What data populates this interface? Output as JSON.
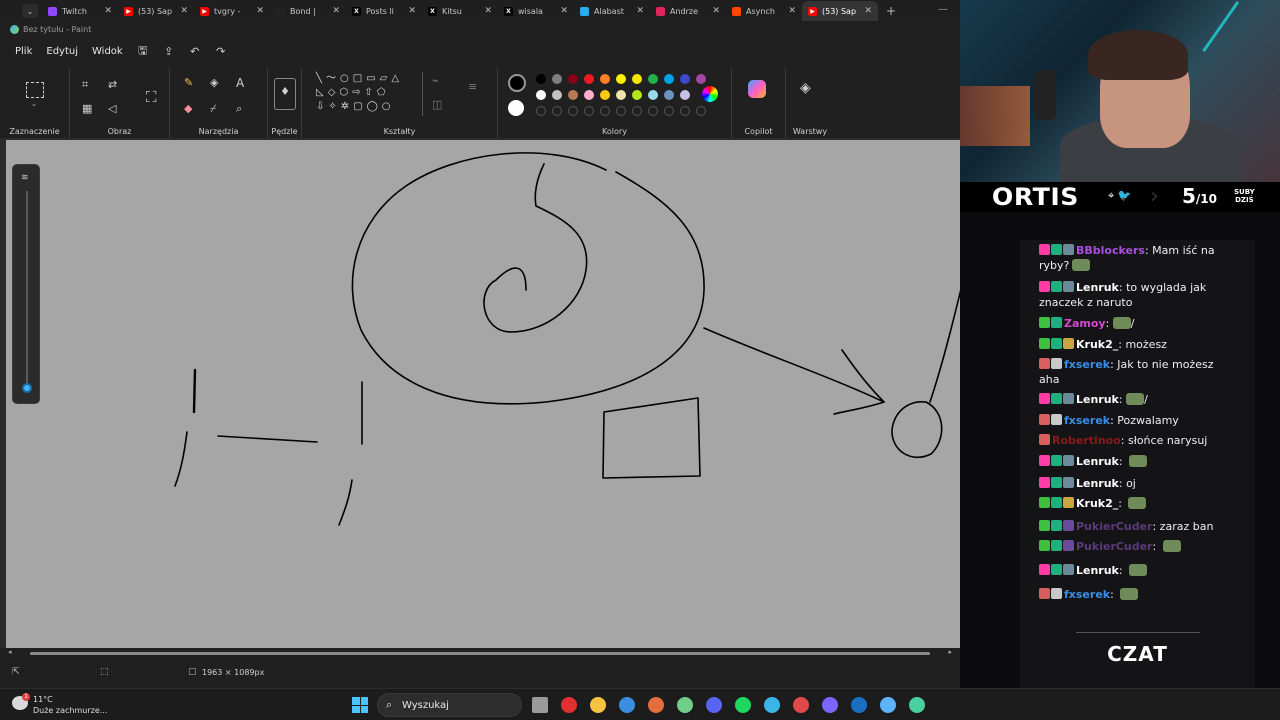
{
  "browser": {
    "tabs": [
      {
        "title": "Twitch",
        "favicon_color": "#9146ff",
        "favicon_glyph": ""
      },
      {
        "title": "(53) Sap",
        "favicon_color": "#ff0000",
        "favicon_glyph": "▶"
      },
      {
        "title": "tvgry -",
        "favicon_color": "#ff0000",
        "favicon_glyph": "▶"
      },
      {
        "title": "Bond |",
        "favicon_color": "#222222",
        "favicon_glyph": ""
      },
      {
        "title": "Posts li",
        "favicon_color": "#000000",
        "favicon_glyph": "X"
      },
      {
        "title": "Kitsu",
        "favicon_color": "#000000",
        "favicon_glyph": "X"
      },
      {
        "title": "wisala",
        "favicon_color": "#000000",
        "favicon_glyph": "X"
      },
      {
        "title": "Alabast",
        "favicon_color": "#2aabee",
        "favicon_glyph": ""
      },
      {
        "title": "Andrze",
        "favicon_color": "#e0245e",
        "favicon_glyph": ""
      },
      {
        "title": "Asynch",
        "favicon_color": "#ff4500",
        "favicon_glyph": ""
      },
      {
        "title": "(53) Sap",
        "favicon_color": "#ff0000",
        "favicon_glyph": "▶",
        "active": true
      }
    ],
    "new_tab": "+",
    "close_glyph": "✕",
    "minimize_glyph": "—"
  },
  "paint": {
    "window_title": "Bez tytułu - Paint",
    "menu": [
      "Plik",
      "Edytuj",
      "Widok"
    ],
    "ribbon_groups": {
      "selection": "Zaznaczenie",
      "image": "Obraz",
      "tools": "Narzędzia",
      "brushes": "Pędzle",
      "shapes": "Kształty",
      "colors": "Kolory",
      "copilot": "Copilot",
      "layers": "Warstwy"
    },
    "palette_row1": [
      "#000000",
      "#7f7f7f",
      "#880015",
      "#ed1c24",
      "#ff7f27",
      "#fff200",
      "#f5e600",
      "#22b14c",
      "#00a2e8",
      "#3f48cc",
      "#a349a4"
    ],
    "palette_row2": [
      "#ffffff",
      "#c3c3c3",
      "#b97a57",
      "#ffaec9",
      "#ffc90e",
      "#efe4b0",
      "#b5e61d",
      "#99d9ea",
      "#7092be",
      "#c8bfe7"
    ],
    "primary_color": "#000000",
    "secondary_color": "#ffffff",
    "canvas_size": "1963 × 1089px"
  },
  "stream": {
    "streamer_name": "ORTIS",
    "subs_current": "5",
    "subs_goal": "/10",
    "subs_label_1": "SUBY",
    "subs_label_2": "DZIŚ",
    "chat_label": "CZAT",
    "messages": [
      {
        "user": "BBblockers",
        "color": "#a94fe0",
        "text": "Mam iść na ryby?",
        "badges": [
          "#ff3ea5",
          "#1fb07f",
          "#6b8a9c"
        ],
        "emote": true
      },
      {
        "user": "Lenruk",
        "color": "#ffffff",
        "text": "to wyglada jak znaczek z naruto",
        "badges": [
          "#ff3ea5",
          "#1fb07f",
          "#6b8a9c"
        ]
      },
      {
        "user": "Zamoy",
        "color": "#d34ad0",
        "text": "/",
        "badges": [
          "#3fbf3f",
          "#1fb07f"
        ],
        "emote": true
      },
      {
        "user": "Kruk2_",
        "color": "#ffffff",
        "text": "możesz",
        "badges": [
          "#3fbf3f",
          "#1fb07f",
          "#c9a640"
        ]
      },
      {
        "user": "fxserek",
        "color": "#3b8ee8",
        "text": "Jak to nie możesz aha",
        "badges": [
          "#d85f5f",
          "#c8c8c8"
        ]
      },
      {
        "user": "Lenruk",
        "color": "#ffffff",
        "text": "/",
        "badges": [
          "#ff3ea5",
          "#1fb07f",
          "#6b8a9c"
        ],
        "emote": true
      },
      {
        "user": "fxserek",
        "color": "#3b8ee8",
        "text": "Pozwalamy",
        "badges": [
          "#d85f5f",
          "#c8c8c8"
        ]
      },
      {
        "user": "Robertinoo",
        "color": "#8b1a1a",
        "text": "słońce narysuj",
        "badges": [
          "#d85f5f"
        ]
      },
      {
        "user": "Lenruk",
        "color": "#ffffff",
        "text": "",
        "badges": [
          "#ff3ea5",
          "#1fb07f",
          "#6b8a9c"
        ],
        "emote": true
      },
      {
        "user": "Lenruk",
        "color": "#ffffff",
        "text": "oj",
        "badges": [
          "#ff3ea5",
          "#1fb07f",
          "#6b8a9c"
        ]
      },
      {
        "user": "Kruk2_",
        "color": "#ffffff",
        "text": "",
        "badges": [
          "#3fbf3f",
          "#1fb07f",
          "#c9a640"
        ],
        "emote": true
      },
      {
        "user": "PukierCuder",
        "color": "#5b3a7a",
        "text": "zaraz ban",
        "badges": [
          "#3fbf3f",
          "#1fb07f",
          "#6a4a9a"
        ]
      },
      {
        "user": "PukierCuder",
        "color": "#5b3a7a",
        "text": "",
        "badges": [
          "#3fbf3f",
          "#1fb07f",
          "#6a4a9a"
        ],
        "emote": true
      },
      {
        "user": "Lenruk",
        "color": "#ffffff",
        "text": "",
        "badges": [
          "#ff3ea5",
          "#1fb07f",
          "#6b8a9c"
        ],
        "emote": true
      },
      {
        "user": "fxserek",
        "color": "#3b8ee8",
        "text": "",
        "badges": [
          "#d85f5f",
          "#c8c8c8"
        ],
        "emote": true
      }
    ]
  },
  "taskbar": {
    "temperature": "11°C",
    "weather": "Duże zachmurze...",
    "search_placeholder": "Wyszukaj",
    "icons": [
      "task-view",
      "opera",
      "files",
      "chrome",
      "chrome-alt",
      "edge-dev",
      "discord",
      "spotify",
      "ccleaner",
      "maps",
      "streamdeck",
      "steam",
      "nvidia",
      "pinned"
    ]
  }
}
